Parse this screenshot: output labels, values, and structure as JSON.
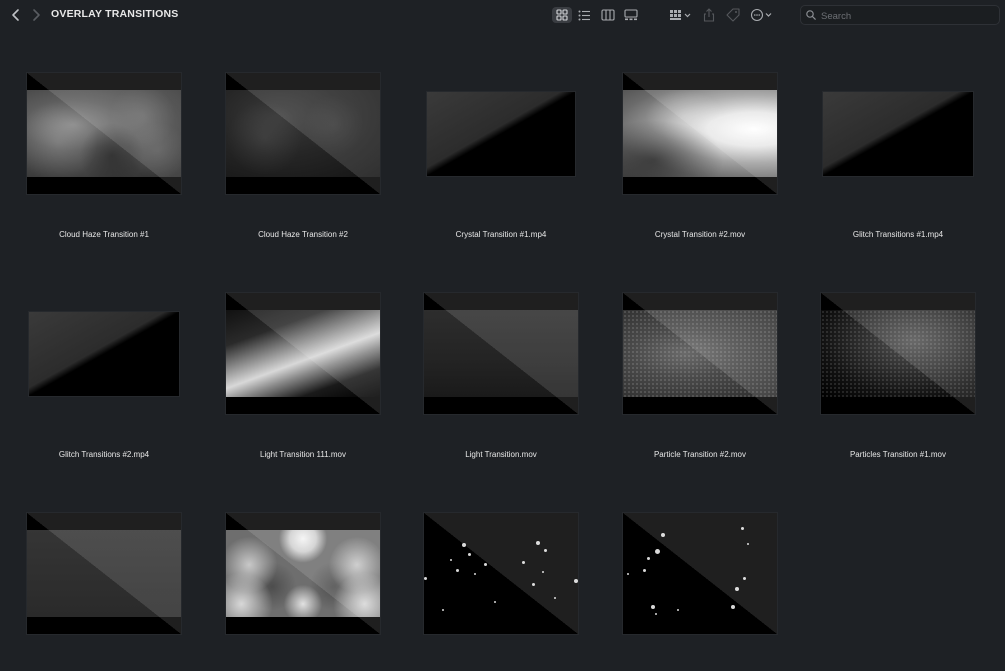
{
  "toolbar": {
    "title": "OVERLAY TRANSITIONS",
    "search_placeholder": "Search"
  },
  "items": [
    {
      "label": "Cloud Haze Transition #1"
    },
    {
      "label": "Cloud Haze Transition #2"
    },
    {
      "label": "Crystal Transition #1.mp4"
    },
    {
      "label": "Crystal Transition #2.mov"
    },
    {
      "label": "Glitch Transitions #1.mp4"
    },
    {
      "label": "Glitch Transitions #2.mp4"
    },
    {
      "label": "Light Transition 111.mov"
    },
    {
      "label": "Light Transition.mov"
    },
    {
      "label": "Particle Transition #2.mov"
    },
    {
      "label": "Particles Transition #1.mov"
    },
    {
      "label": ""
    },
    {
      "label": ""
    },
    {
      "label": ""
    },
    {
      "label": ""
    }
  ]
}
